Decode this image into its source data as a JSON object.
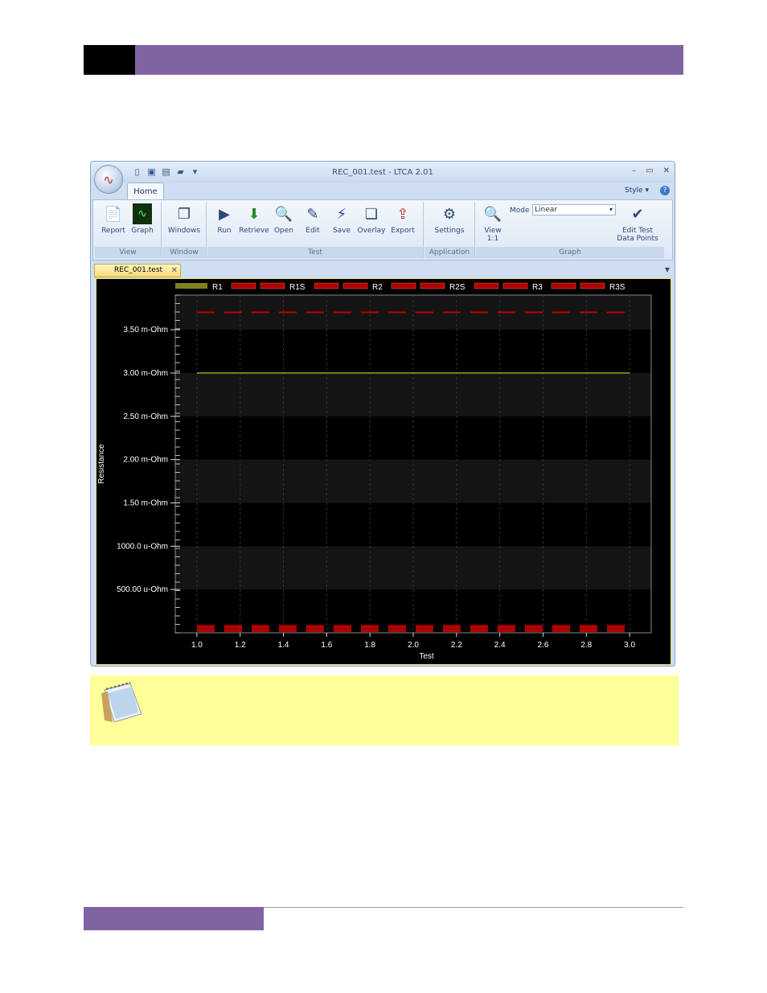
{
  "window": {
    "title": "REC_001.test - LTCA 2.01",
    "controls": [
      "–",
      "▭",
      "✕"
    ]
  },
  "ribbon": {
    "tabs": [
      {
        "label": "Home"
      }
    ],
    "style_label": "Style",
    "groups": {
      "view": {
        "label": "View",
        "buttons": [
          "Report",
          "Graph"
        ]
      },
      "window": {
        "label": "Window",
        "buttons": [
          "Windows"
        ]
      },
      "test": {
        "label": "Test",
        "buttons": [
          "Run",
          "Retrieve",
          "Open",
          "Edit",
          "Save",
          "Overlay",
          "Export"
        ]
      },
      "application": {
        "label": "Application",
        "buttons": [
          "Settings"
        ]
      },
      "graph": {
        "label": "Graph",
        "mode_label": "Mode",
        "mode_value": "Linear",
        "view_label": "View",
        "view_ratio": "1:1",
        "edit_label_1": "Edit Test",
        "edit_label_2": "Data Points"
      }
    }
  },
  "document_tab": {
    "label": "REC_001.test"
  },
  "chart_data": {
    "type": "line",
    "legend": [
      "R1",
      "R1S",
      "R2",
      "R2S",
      "R3",
      "R3S"
    ],
    "legend_colors": [
      "#808020",
      "#b00000",
      "#b00000",
      "#b00000",
      "#b00000",
      "#b00000"
    ],
    "legend_placement": "top",
    "ylabel": "Resistance",
    "xlabel": "Test",
    "x_ticks": [
      "1.0",
      "1.2",
      "1.4",
      "1.6",
      "1.8",
      "2.0",
      "2.2",
      "2.4",
      "2.6",
      "2.8",
      "3.0"
    ],
    "y_ticks": [
      {
        "value": 0.0005,
        "label": "500.00 u-Ohm"
      },
      {
        "value": 0.001,
        "label": "1000.0 u-Ohm"
      },
      {
        "value": 0.0015,
        "label": "1.50 m-Ohm"
      },
      {
        "value": 0.002,
        "label": "2.00 m-Ohm"
      },
      {
        "value": 0.0025,
        "label": "2.50 m-Ohm"
      },
      {
        "value": 0.003,
        "label": "3.00 m-Ohm"
      },
      {
        "value": 0.0035,
        "label": "3.50 m-Ohm"
      }
    ],
    "xlim": [
      0.9,
      3.1
    ],
    "ylim": [
      0.0,
      0.0039
    ],
    "series": [
      {
        "name": "R1",
        "x": [
          1.0,
          3.0
        ],
        "y": [
          0.003,
          0.003
        ],
        "color": "#a0a020",
        "style": "solid"
      },
      {
        "name": "R1S",
        "x": [
          1.0,
          3.0
        ],
        "y": [
          0.0037,
          0.0037
        ],
        "color": "#c00000",
        "style": "dashed"
      },
      {
        "name": "R2",
        "x": [
          1.0,
          3.0
        ],
        "y": [
          8e-05,
          8e-05
        ],
        "color": "#c00000",
        "style": "dashed"
      },
      {
        "name": "R2S",
        "x": [
          1.0,
          3.0
        ],
        "y": [
          6e-05,
          6e-05
        ],
        "color": "#c00000",
        "style": "dashed"
      },
      {
        "name": "R3",
        "x": [
          1.0,
          3.0
        ],
        "y": [
          4e-05,
          4e-05
        ],
        "color": "#c00000",
        "style": "dashed"
      },
      {
        "name": "R3S",
        "x": [
          1.0,
          3.0
        ],
        "y": [
          2e-05,
          2e-05
        ],
        "color": "#c00000",
        "style": "dashed"
      }
    ],
    "grid": true
  },
  "colors": {
    "header_purple": "#8064a2",
    "note_background": "#ffff99"
  }
}
